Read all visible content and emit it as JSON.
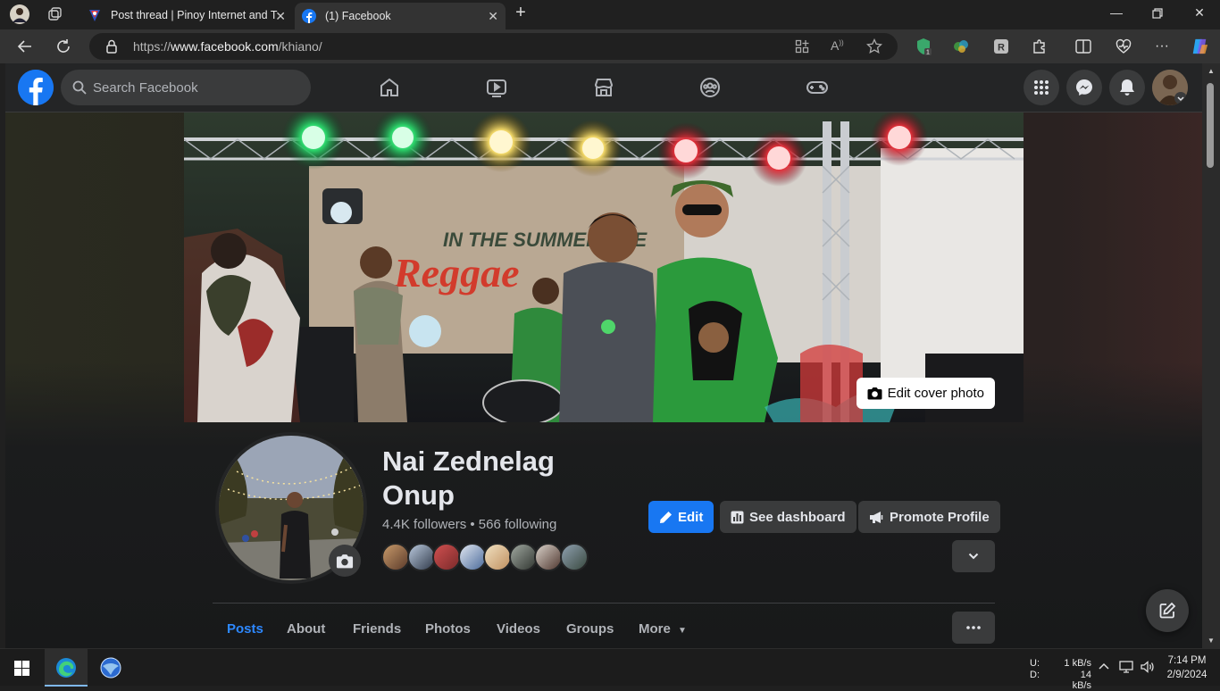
{
  "browser": {
    "tabs": [
      {
        "title": "Post thread | Pinoy Internet and T",
        "active": false
      },
      {
        "title": "(1) Facebook",
        "active": true
      }
    ],
    "url_prefix": "https://",
    "url_domain": "www.facebook.com",
    "url_path": "/khiano/"
  },
  "fb": {
    "search_placeholder": "Search Facebook",
    "edit_cover_label": "Edit cover photo",
    "name_line1": "Nai Zednelag",
    "name_line2": "Onup",
    "stats": "4.4K followers • 566 following",
    "buttons": {
      "edit": "Edit",
      "dashboard": "See dashboard",
      "promote": "Promote Profile"
    },
    "tabs": [
      "Posts",
      "About",
      "Friends",
      "Photos",
      "Videos",
      "Groups",
      "More"
    ],
    "more_caret": "▼"
  },
  "taskbar": {
    "upload_label": "U:",
    "download_label": "D:",
    "upload_speed": "1 kB/s",
    "download_speed": "14 kB/s",
    "time": "7:14 PM",
    "date": "2/9/2024"
  },
  "colors": {
    "fb_blue": "#1877f2",
    "active_tab_text": "#2d88ff",
    "surface": "#242526",
    "button_gray": "#3a3b3c"
  }
}
